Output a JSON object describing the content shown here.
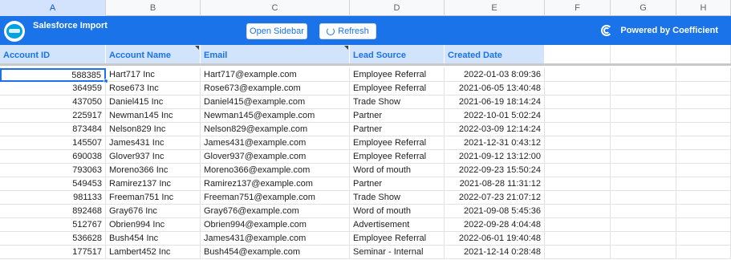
{
  "column_letters": [
    "A",
    "B",
    "C",
    "D",
    "E",
    "F",
    "G",
    "H"
  ],
  "banner": {
    "title": "Salesforce Import",
    "open_sidebar_label": "Open Sidebar",
    "refresh_label": "Refresh",
    "powered_by": "Powered by Coefficient",
    "brand_color": "#1a73e8"
  },
  "headers": [
    "Account ID",
    "Account Name",
    "Email",
    "Lead Source",
    "Created Date"
  ],
  "rows": [
    {
      "id": "588385",
      "name": "Hart717 Inc",
      "email": "Hart717@example.com",
      "source": "Employee Referral",
      "created": "2022-01-03 8:09:36"
    },
    {
      "id": "364959",
      "name": "Rose673 Inc",
      "email": "Rose673@example.com",
      "source": "Employee Referral",
      "created": "2021-06-05 13:40:48"
    },
    {
      "id": "437050",
      "name": "Daniel415 Inc",
      "email": "Daniel415@example.com",
      "source": "Trade Show",
      "created": "2021-06-19 18:14:24"
    },
    {
      "id": "225917",
      "name": "Newman145 Inc",
      "email": "Newman145@example.com",
      "source": "Partner",
      "created": "2022-10-01 5:02:24"
    },
    {
      "id": "873484",
      "name": "Nelson829 Inc",
      "email": "Nelson829@example.com",
      "source": "Partner",
      "created": "2022-03-09 12:14:24"
    },
    {
      "id": "145507",
      "name": "James431 Inc",
      "email": "James431@example.com",
      "source": "Employee Referral",
      "created": "2021-12-31 0:43:12"
    },
    {
      "id": "690038",
      "name": "Glover937 Inc",
      "email": "Glover937@example.com",
      "source": "Employee Referral",
      "created": "2021-09-12 13:12:00"
    },
    {
      "id": "793063",
      "name": "Moreno366 Inc",
      "email": "Moreno366@example.com",
      "source": "Word of mouth",
      "created": "2022-09-23 15:50:24"
    },
    {
      "id": "549453",
      "name": "Ramirez137 Inc",
      "email": "Ramirez137@example.com",
      "source": "Partner",
      "created": "2021-08-28 11:31:12"
    },
    {
      "id": "981133",
      "name": "Freeman751 Inc",
      "email": "Freeman751@example.com",
      "source": "Trade Show",
      "created": "2022-07-23 21:07:12"
    },
    {
      "id": "892468",
      "name": "Gray676 Inc",
      "email": "Gray676@example.com",
      "source": "Word of mouth",
      "created": "2021-09-08 5:45:36"
    },
    {
      "id": "512767",
      "name": "Obrien994 Inc",
      "email": "Obrien994@example.com",
      "source": "Advertisement",
      "created": "2022-09-28 4:04:48"
    },
    {
      "id": "536628",
      "name": "Bush454 Inc",
      "email": "James431@example.com",
      "source": "Employee Referral",
      "created": "2022-06-01 19:40:48"
    },
    {
      "id": "177517",
      "name": "Lambert452 Inc",
      "email": "Bush454@example.com",
      "source": "Seminar - Internal",
      "created": "2021-12-14 0:28:48"
    }
  ]
}
